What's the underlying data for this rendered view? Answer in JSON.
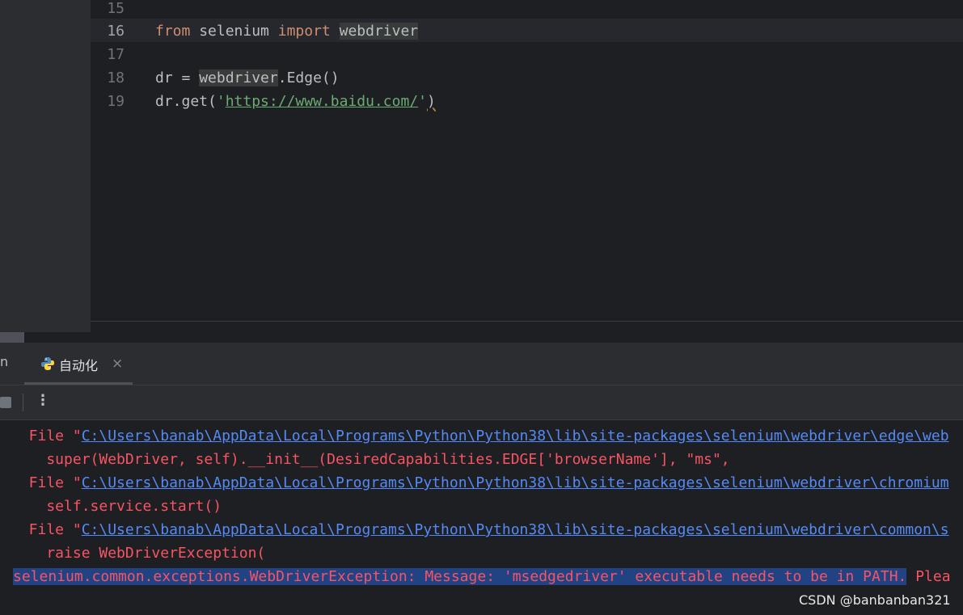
{
  "editor": {
    "line_numbers": [
      "15",
      "16",
      "17",
      "18",
      "19"
    ],
    "line16": {
      "kw1": "from",
      "mid": " selenium ",
      "kw2": "import",
      "sp": " ",
      "mod": "webdriver"
    },
    "line18": {
      "pre": "dr = ",
      "mod": "webdriver",
      "post": ".Edge()"
    },
    "line19": {
      "pre": "dr.get(",
      "q1": "'",
      "url": "https://www.baidu.com/",
      "q2": "'",
      "close": ")"
    }
  },
  "run": {
    "partial_tab": "n",
    "tab_label": "自动化",
    "tab_close": "×",
    "more_icon": "⋮"
  },
  "console": {
    "lines": [
      {
        "prefix": "  File \"",
        "path": "C:\\Users\\banab\\AppData\\Local\\Programs\\Python\\Python38\\lib\\site-packages\\selenium\\webdriver\\edge\\web"
      },
      {
        "text": "    super(WebDriver, self).__init__(DesiredCapabilities.EDGE['browserName'], \"ms\","
      },
      {
        "prefix": "  File \"",
        "path": "C:\\Users\\banab\\AppData\\Local\\Programs\\Python\\Python38\\lib\\site-packages\\selenium\\webdriver\\chromium"
      },
      {
        "text": "    self.service.start()"
      },
      {
        "prefix": "  File \"",
        "path": "C:\\Users\\banab\\AppData\\Local\\Programs\\Python\\Python38\\lib\\site-packages\\selenium\\webdriver\\common\\s"
      },
      {
        "text": "    raise WebDriverException("
      },
      {
        "highlighted": "selenium.common.exceptions.WebDriverException: Message: 'msedgedriver' executable needs to be in PATH.",
        "rest": " Plea"
      }
    ]
  },
  "watermark": "CSDN @banbanban321",
  "colors": {
    "background": "#1e1f22",
    "keyword": "#cf8e6d",
    "string": "#6aab73",
    "error": "#f75464",
    "link": "#548af7",
    "selection": "#214283"
  }
}
